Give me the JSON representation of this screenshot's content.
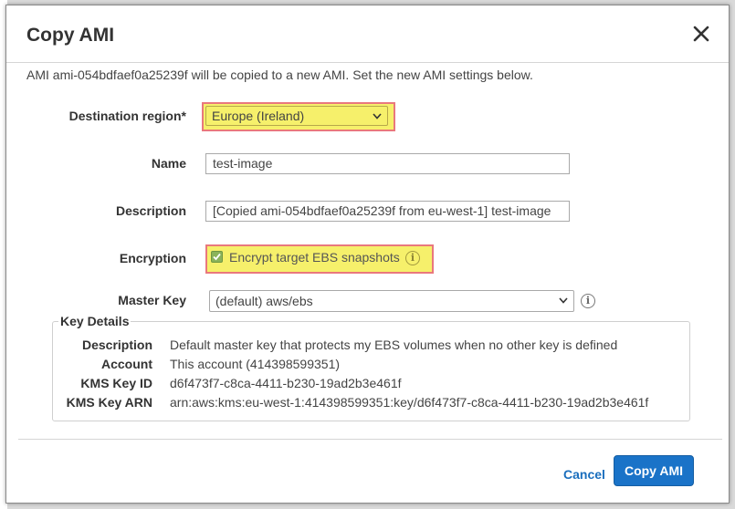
{
  "dialog": {
    "title": "Copy AMI",
    "intro": "AMI ami-054bdfaef0a25239f will be copied to a new AMI. Set the new AMI settings below."
  },
  "form": {
    "destination_region": {
      "label": "Destination region*",
      "value": "Europe (Ireland)"
    },
    "name": {
      "label": "Name",
      "value": "test-image"
    },
    "description": {
      "label": "Description",
      "value": "[Copied ami-054bdfaef0a25239f from eu-west-1] test-image"
    },
    "encryption": {
      "label": "Encryption",
      "checkbox_label": "Encrypt target EBS snapshots",
      "checked": true
    },
    "master_key": {
      "label": "Master Key",
      "value": "(default) aws/ebs"
    }
  },
  "key_details": {
    "legend": "Key Details",
    "rows": [
      {
        "label": "Description",
        "value": "Default master key that protects my EBS volumes when no other key is defined"
      },
      {
        "label": "Account",
        "value": "This account (414398599351)"
      },
      {
        "label": "KMS Key ID",
        "value": "d6f473f7-c8ca-4411-b230-19ad2b3e461f"
      },
      {
        "label": "KMS Key ARN",
        "value": "arn:aws:kms:eu-west-1:414398599351:key/d6f473f7-c8ca-4411-b230-19ad2b3e461f"
      }
    ]
  },
  "footer": {
    "cancel_label": "Cancel",
    "submit_label": "Copy AMI"
  },
  "colors": {
    "highlight_fill": "#f6f06b",
    "highlight_border": "#e9787d",
    "primary": "#1a73c8",
    "link": "#1a6ebd"
  },
  "icons": {
    "close": "close-icon",
    "chevron": "chevron-down-icon",
    "info": "info-icon",
    "check": "checkbox-check-icon"
  }
}
